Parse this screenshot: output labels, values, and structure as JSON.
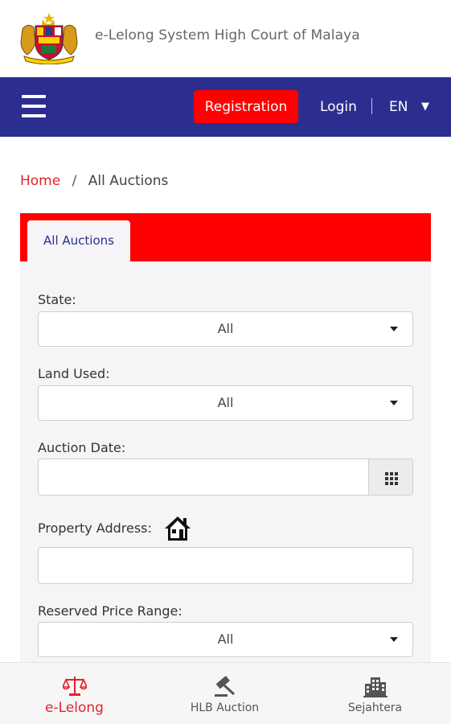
{
  "header": {
    "site_title": "e-Lelong System High Court of Malaya",
    "logo_icon": "malaysia-coat-of-arms-logo"
  },
  "navbar": {
    "menu_icon": "hamburger-icon",
    "registration_label": "Registration",
    "login_label": "Login",
    "language": "EN",
    "colors": {
      "bar": "#2b2e8f",
      "registration": "#ff0000"
    }
  },
  "breadcrumb": {
    "home": "Home",
    "separator": "/",
    "current": "All Auctions"
  },
  "panel": {
    "tab_label": "All Auctions",
    "accent_color": "#ff0000"
  },
  "form": {
    "state": {
      "label": "State:",
      "value": "All"
    },
    "land_used": {
      "label": "Land Used:",
      "value": "All"
    },
    "auction_date": {
      "label": "Auction Date:",
      "value": "",
      "button_icon": "calendar-grid-icon"
    },
    "property_address": {
      "label": "Property Address:",
      "value": "",
      "icon": "house-icon"
    },
    "reserved_price_range": {
      "label": "Reserved Price Range:",
      "value": "All"
    }
  },
  "bottom_nav": {
    "items": [
      {
        "label": "e-Lelong",
        "icon": "scales-icon",
        "active": true
      },
      {
        "label": "HLB Auction",
        "icon": "gavel-icon",
        "active": false
      },
      {
        "label": "Sejahtera",
        "icon": "building-icon",
        "active": false
      }
    ],
    "active_color": "#e6212a"
  }
}
